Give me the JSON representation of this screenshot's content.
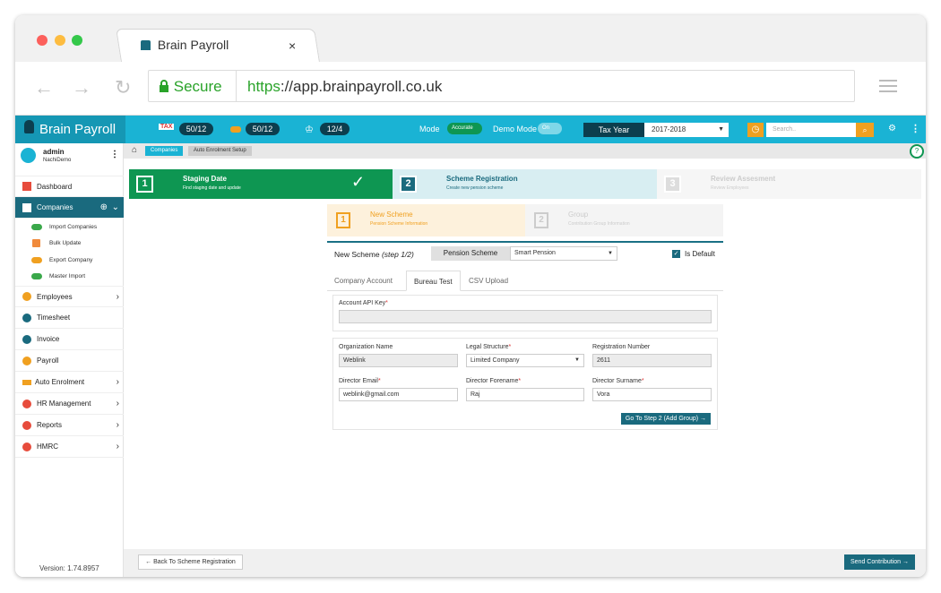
{
  "browser": {
    "tab_title": "Brain Payroll",
    "tab_close": "×",
    "secure_label": "Secure",
    "url_scheme": "https",
    "url_rest": "://app.brainpayroll.co.uk",
    "icons": [
      "back-arrow-icon",
      "forward-arrow-icon",
      "reload-icon",
      "lock-icon",
      "menu-icon"
    ]
  },
  "topnav": {
    "brand": "Brain Payroll",
    "counter1": "50/12",
    "counter2": "50/12",
    "counter3": "12/4",
    "mode_label": "Mode",
    "mode_toggle": "Accurate",
    "demo_label": "Demo Mode",
    "demo_toggle": "On",
    "tax_year_label": "Tax Year",
    "tax_year_value": "2017-2018",
    "search_placeholder": "Search.."
  },
  "sidebar": {
    "user_name": "admin",
    "user_sub": "NachiDemo",
    "items": [
      {
        "label": "Dashboard"
      },
      {
        "label": "Companies"
      },
      {
        "label": "Employees"
      },
      {
        "label": "Timesheet"
      },
      {
        "label": "Invoice"
      },
      {
        "label": "Payroll"
      },
      {
        "label": "Auto Enrolment"
      },
      {
        "label": "HR Management"
      },
      {
        "label": "Reports"
      },
      {
        "label": "HMRC"
      }
    ],
    "sub_items": [
      {
        "label": "Import Companies"
      },
      {
        "label": "Bulk Update"
      },
      {
        "label": "Export Company"
      },
      {
        "label": "Master Import"
      }
    ],
    "version": "Version: 1.74.8957"
  },
  "breadcrumb": {
    "c1": "Companies",
    "c2": "Auto Enrolment Setup"
  },
  "stages": [
    {
      "num": "1",
      "title": "Staging Date",
      "sub": "Find staging date and update"
    },
    {
      "num": "2",
      "title": "Scheme Registration",
      "sub": "Create new pension scheme"
    },
    {
      "num": "3",
      "title": "Review Assesment",
      "sub": "Review Employees"
    }
  ],
  "substeps": [
    {
      "num": "1",
      "title": "New Scheme",
      "sub": "Pension Scheme Information"
    },
    {
      "num": "2",
      "title": "Group",
      "sub": "Contribution Group Information"
    }
  ],
  "form": {
    "title": "New Scheme",
    "step": "(step 1/2)",
    "scheme_label": "Pension Scheme",
    "scheme_value": "Smart Pension",
    "is_default": "Is Default",
    "tabs": [
      "Company Account",
      "Bureau Test",
      "CSV Upload"
    ],
    "api_key_label": "Account API Key",
    "org_name_label": "Organization Name",
    "org_name": "Weblink",
    "legal_label": "Legal Structure",
    "legal_value": "Limited Company",
    "reg_label": "Registration Number",
    "reg_value": "2611",
    "email_label": "Director Email",
    "email_value": "weblink@gmail.com",
    "forename_label": "Director Forename",
    "forename_value": "Raj",
    "surname_label": "Director Surname",
    "surname_value": "Vora",
    "required_mark": "*",
    "next_btn": "Go To Step 2 (Add Group) →"
  },
  "footer": {
    "back_btn": "← Back To Scheme Registration",
    "send_btn": "Send Contribution →"
  },
  "colors": {
    "teal": "#1ab3d4",
    "dark": "#0c3e4e",
    "green": "#0e9652",
    "accent": "#f0a020"
  }
}
